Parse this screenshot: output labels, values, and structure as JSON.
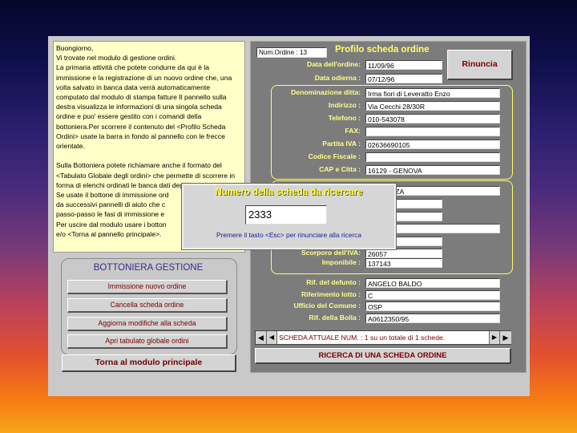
{
  "info_text": "Buongiorno,\nVi trovate nel modulo di gestione ordini.\nLa primaria attività che potete condurre da qui è la immissione e la registrazione di un nuovo ordine che, una volta salvato in banca data verrà automaticamente computato dal modulo di stampa fatture Il pannello sulla destra visualizza le informazioni di una singola scheda ordine e puo' essere gestito con i comandi della bottoniera.Per scorrere il contenuto del <Profilo Scheda Ordini> usate la barra in fondo al pannello con le frecce orientate.\n\nSulla Bottoniera potete richiamare anche il formato del <Tabulato Globale degli ordini> che permette di scorrere in forma di elenchi ordinati le banca dati degli ordini.\nSe usate il bottone di immissione ord\nda successivi pannelli di aiuto che c\npasso-passo le fasi di immissione e\nPer uscire dal modulo usare i botton\ne/o <Torna al pannello principale>.",
  "bottoniera": {
    "title": "BOTTONIERA GESTIONE",
    "buttons": [
      "Immissione nuovo ordine",
      "Cancella scheda ordine",
      "Aggiorna modifiche alla scheda",
      "Apri tabulato globale ordini"
    ],
    "main_button": "Torna al modulo principale"
  },
  "profile": {
    "num_ordine": "Num.Ordine : 13",
    "title": "Profilo scheda ordine",
    "rinuncia": "Rinuncia",
    "fields_top": [
      {
        "label": "Data dell'ordine:",
        "value": "11/09/96"
      },
      {
        "label": "Data odierna :",
        "value": "07/12/96"
      }
    ],
    "fields_ditta": [
      {
        "label": "Denominazione ditta:",
        "value": "Irma fiori di Leveratto Enzo"
      },
      {
        "label": "Indirizzo :",
        "value": "Via Cecchi 28/30R"
      },
      {
        "label": "Telefono :",
        "value": "010-543078"
      },
      {
        "label": "FAX:",
        "value": ""
      },
      {
        "label": "Partita IVA :",
        "value": "02636690105"
      },
      {
        "label": "Codice Fiscale :",
        "value": ""
      },
      {
        "label": "CAP e Citta :",
        "value": "16129 - GENOVA"
      }
    ],
    "fields_middle": {
      "denominazione_value": "SENTANZA",
      "amount_partial": "0",
      "scorporo_label": "Scorporo dell'IVA:",
      "scorporo_value": "26057",
      "imponibile_label": "Imponibile :",
      "imponibile_value": "137143"
    },
    "fields_bottom": [
      {
        "label": "Rif. del defunto :",
        "value": "ANGELO BALDO"
      },
      {
        "label": "Riferimento lotto :",
        "value": "C"
      },
      {
        "label": "Ufficio del Comune :",
        "value": "OSP"
      },
      {
        "label": "Rif. della Bolla :",
        "value": "A0612350/95"
      }
    ],
    "nav_text": "SCHEDA ATTUALE NUM. : 1 su un totale di  1 schede.",
    "search_button": "RICERCA DI UNA SCHEDA ORDINE"
  },
  "dialog": {
    "title": "Numero della scheda da ricercare",
    "value": "2333",
    "hint": "Premere il tasto <Esc> per rinunciare alla ricerca"
  },
  "colors": {
    "label_yellow": "#ffff8a",
    "panel_gray": "#7c7c7c",
    "dialog_title_yellow": "#ffff33",
    "hint_blue": "#1a1aa0"
  }
}
